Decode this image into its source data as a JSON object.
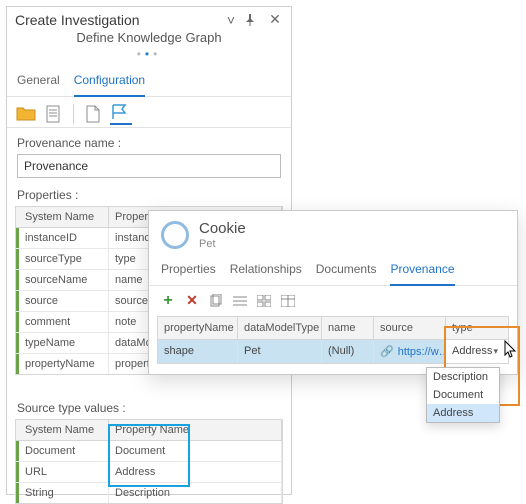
{
  "panel": {
    "title": "Create Investigation",
    "subtitle": "Define Knowledge Graph",
    "tabs": {
      "general": "General",
      "configuration": "Configuration"
    },
    "provenance_label": "Provenance name :",
    "provenance_value": "Provenance",
    "properties_label": "Properties :",
    "properties_columns": {
      "system": "System Name",
      "property": "Property Name"
    },
    "properties_rows": [
      {
        "system": "instanceID",
        "property": "instanceID"
      },
      {
        "system": "sourceType",
        "property": "type"
      },
      {
        "system": "sourceName",
        "property": "name"
      },
      {
        "system": "source",
        "property": "source"
      },
      {
        "system": "comment",
        "property": "note"
      },
      {
        "system": "typeName",
        "property": "dataModelType"
      },
      {
        "system": "propertyName",
        "property": "propertyName"
      }
    ],
    "source_values_label": "Source type values :",
    "source_values_columns": {
      "system": "System Name",
      "property": "Property Name"
    },
    "source_values_rows": [
      {
        "system": "Document",
        "property": "Document"
      },
      {
        "system": "URL",
        "property": "Address"
      },
      {
        "system": "String",
        "property": "Description"
      }
    ]
  },
  "popover": {
    "title": "Cookie",
    "subtitle": "Pet",
    "tabs": {
      "properties": "Properties",
      "relationships": "Relationships",
      "documents": "Documents",
      "provenance": "Provenance"
    },
    "grid_columns": {
      "propertyName": "propertyName",
      "dataModelType": "dataModelType",
      "name": "name",
      "source": "source",
      "type": "type"
    },
    "row": {
      "propertyName": "shape",
      "dataModelType": "Pet",
      "name": "(Null)",
      "source": "https://w…",
      "type": "Address"
    },
    "dropdown": {
      "opt1": "Description",
      "opt2": "Document",
      "opt3": "Address"
    }
  },
  "icons": {
    "collapse": "collapse-icon",
    "pin": "pin-icon",
    "close": "close-icon",
    "folder": "folder-icon",
    "page": "page-icon",
    "newpage": "new-page-icon",
    "flag": "flag-icon",
    "add": "add-icon",
    "delete": "delete-icon",
    "copy": "copy-icon",
    "list": "list-icon",
    "grid": "grid-icon",
    "table": "table-icon",
    "circle": "entity-icon",
    "link": "link-icon"
  }
}
